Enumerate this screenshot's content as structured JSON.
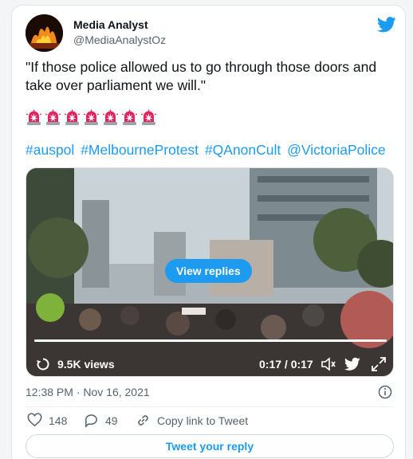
{
  "author": {
    "name": "Media Analyst",
    "handle": "@MediaAnalystOz"
  },
  "tweet": {
    "text": "\"If those police allowed us to go through those doors and take over parliament we will.\"",
    "emoji_count": 7,
    "emoji": "police-car-light",
    "hashtags": [
      "#auspol",
      "#MelbourneProtest",
      "#QAnonCult",
      "@VictoriaPolice"
    ]
  },
  "video": {
    "overlay_button": "View replies",
    "views": "9.5K views",
    "timecode": "0:17 / 0:17",
    "progress": 1.0
  },
  "meta": {
    "timestamp": "12:38 PM · Nov 16, 2021"
  },
  "actions": {
    "likes": "148",
    "replies": "49",
    "copy_link": "Copy link to Tweet"
  },
  "reply_button": "Tweet your reply",
  "colors": {
    "accent": "#1d9bf0",
    "siren": "#e0245e"
  },
  "icons": [
    "twitter-bird-icon",
    "replay-icon",
    "volume-icon",
    "expand-icon",
    "info-icon",
    "heart-icon",
    "reply-icon",
    "link-icon"
  ]
}
